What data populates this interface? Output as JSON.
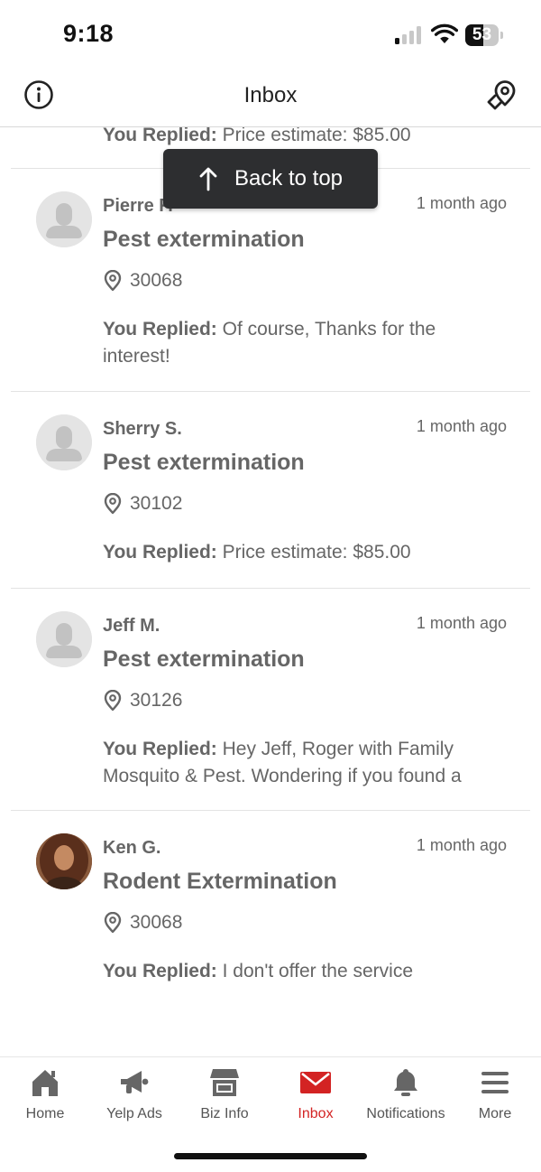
{
  "status_bar": {
    "time": "9:18",
    "battery": "53",
    "battery_level": 0.53,
    "signal_bars_active": 1
  },
  "header": {
    "title": "Inbox",
    "left_icon": "info-icon",
    "right_icon": "map-pin-icon"
  },
  "partial_reply": {
    "label": "You Replied:",
    "text": " Price estimate: $85.00"
  },
  "back_to_top": {
    "label": "Back to top",
    "icon": "arrow-up-icon"
  },
  "leads": [
    {
      "name": "Pierre F.",
      "time": "1 month ago",
      "service": "Pest extermination",
      "zip": "30068",
      "reply_label": "You Replied:",
      "reply_text": " Of course, Thanks for the interest!",
      "avatar": "default-avatar"
    },
    {
      "name": "Sherry S.",
      "time": "1 month ago",
      "service": "Pest extermination",
      "zip": "30102",
      "reply_label": "You Replied:",
      "reply_text": " Price estimate: $85.00",
      "avatar": "default-avatar"
    },
    {
      "name": "Jeff M.",
      "time": "1 month ago",
      "service": "Pest extermination",
      "zip": "30126",
      "reply_label": "You Replied:",
      "reply_text": " Hey Jeff, Roger with Family Mosquito & Pest. Wondering if you found a",
      "avatar": "default-avatar"
    },
    {
      "name": "Ken G.",
      "time": "1 month ago",
      "service": "Rodent Extermination",
      "zip": "30068",
      "reply_label": "You Replied:",
      "reply_text": " I don't offer the service",
      "avatar": "photo-avatar"
    }
  ],
  "tabs": [
    {
      "label": "Home",
      "icon": "home-icon",
      "active": false
    },
    {
      "label": "Yelp Ads",
      "icon": "megaphone-icon",
      "active": false
    },
    {
      "label": "Biz Info",
      "icon": "storefront-icon",
      "active": false
    },
    {
      "label": "Inbox",
      "icon": "mail-icon",
      "active": true
    },
    {
      "label": "Notifications",
      "icon": "bell-icon",
      "active": false
    },
    {
      "label": "More",
      "icon": "menu-icon",
      "active": false
    }
  ],
  "colors": {
    "accent": "#d32323",
    "text": "#666666",
    "toast_bg": "#2d2e30",
    "divider": "#e3e3e3"
  }
}
